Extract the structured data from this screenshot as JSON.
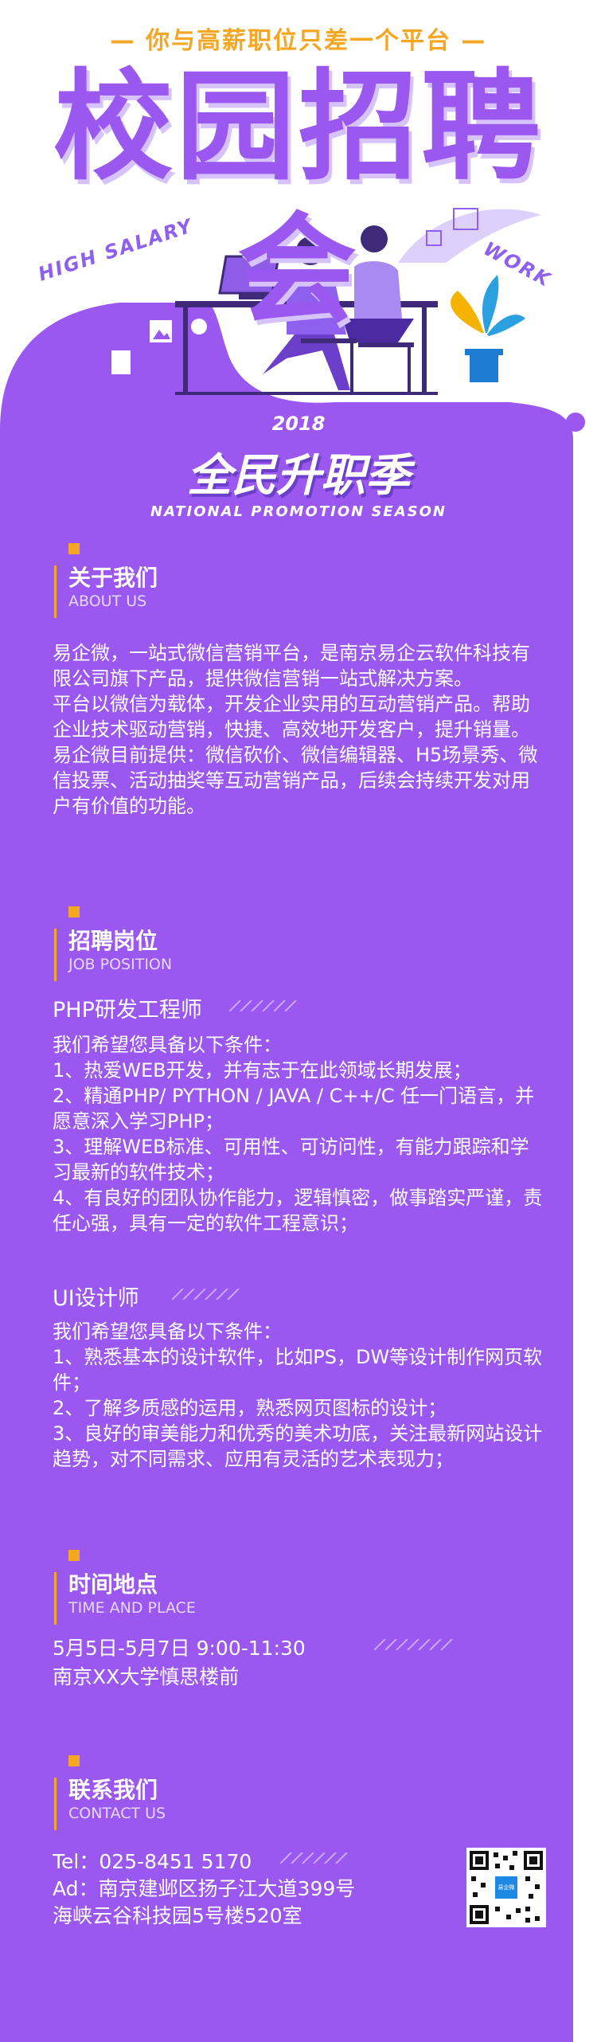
{
  "header": {
    "tagline": "— 你与高薪职位只差一个平台 —",
    "title": "校园招聘会",
    "deco_left": "HIGH SALARY",
    "deco_right": "WORK"
  },
  "season": {
    "year": "2018",
    "title": "全民升职季",
    "subtitle": "NATIONAL PROMOTION SEASON"
  },
  "colors": {
    "purple": "#9a58f0",
    "accent": "#f5a623",
    "white": "#ffffff"
  },
  "about": {
    "title_cn": "关于我们",
    "title_en": "ABOUT US",
    "paragraphs": [
      "易企微，一站式微信营销平台，是南京易企云软件科技有限公司旗下产品，提供微信营销一站式解决方案。",
      "平台以微信为载体，开发企业实用的互动营销产品。帮助企业技术驱动营销，快捷、高效地开发客户，提升销量。",
      "易企微目前提供：微信砍价、微信编辑器、H5场景秀、微信投票、活动抽奖等互动营销产品，后续会持续开发对用户有价值的功能。"
    ]
  },
  "jobs": {
    "title_cn": "招聘岗位",
    "title_en": "JOB POSITION",
    "positions": [
      {
        "name": "PHP研发工程师",
        "lines": [
          "我们希望您具备以下条件：",
          "1、热爱WEB开发，并有志于在此领域长期发展；",
          "2、精通PHP/ PYTHON / JAVA / C++/C 任一门语言，并愿意深入学习PHP；",
          "3、理解WEB标准、可用性、可访问性，有能力跟踪和学习最新的软件技术；",
          "4、有良好的团队协作能力，逻辑慎密，做事踏实严谨，责任心强，具有一定的软件工程意识；"
        ]
      },
      {
        "name": "UI设计师",
        "lines": [
          "我们希望您具备以下条件：",
          "1、熟悉基本的设计软件，比如PS，DW等设计制作网页软件；",
          "2、了解多质感的运用，熟悉网页图标的设计；",
          "3、良好的审美能力和优秀的美术功底，关注最新网站设计趋势，对不同需求、应用有灵活的艺术表现力；"
        ]
      }
    ]
  },
  "time_place": {
    "title_cn": "时间地点",
    "title_en": "TIME AND PLACE",
    "time": "5月5日-5月7日   9:00-11:30",
    "place": "南京XX大学慎思楼前"
  },
  "contact": {
    "title_cn": "联系我们",
    "title_en": "CONTACT US",
    "tel": "Tel：025-8451 5170",
    "address_1": "Ad：南京建邺区扬子江大道399号",
    "address_2": "海峡云谷科技园5号楼520室",
    "qr_label": "易企微"
  }
}
